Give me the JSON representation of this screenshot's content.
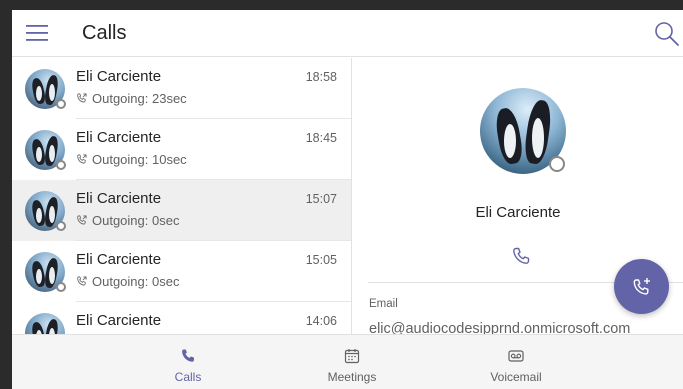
{
  "header": {
    "title": "Calls",
    "menu_icon": "hamburger-menu-icon",
    "search_icon": "search-icon"
  },
  "calls": [
    {
      "name": "Eli Carciente",
      "time": "18:58",
      "detail": "Outgoing: 23sec",
      "selected": false
    },
    {
      "name": "Eli Carciente",
      "time": "18:45",
      "detail": "Outgoing: 10sec",
      "selected": false
    },
    {
      "name": "Eli Carciente",
      "time": "15:07",
      "detail": "Outgoing: 0sec",
      "selected": true
    },
    {
      "name": "Eli Carciente",
      "time": "15:05",
      "detail": "Outgoing: 0sec",
      "selected": false
    },
    {
      "name": "Eli Carciente",
      "time": "14:06",
      "detail": "",
      "selected": false
    }
  ],
  "detail": {
    "name": "Eli Carciente",
    "email_label": "Email",
    "email_value": "elic@audiocodesipprnd.onmicrosoft.com"
  },
  "nav": [
    {
      "label": "Calls",
      "icon": "phone-icon",
      "active": true
    },
    {
      "label": "Meetings",
      "icon": "calendar-icon",
      "active": false
    },
    {
      "label": "Voicemail",
      "icon": "voicemail-icon",
      "active": false
    }
  ],
  "colors": {
    "accent": "#6264a7",
    "selected_row": "#efefef",
    "secondary_text": "#616161",
    "nav_background": "#f5f5f5"
  }
}
